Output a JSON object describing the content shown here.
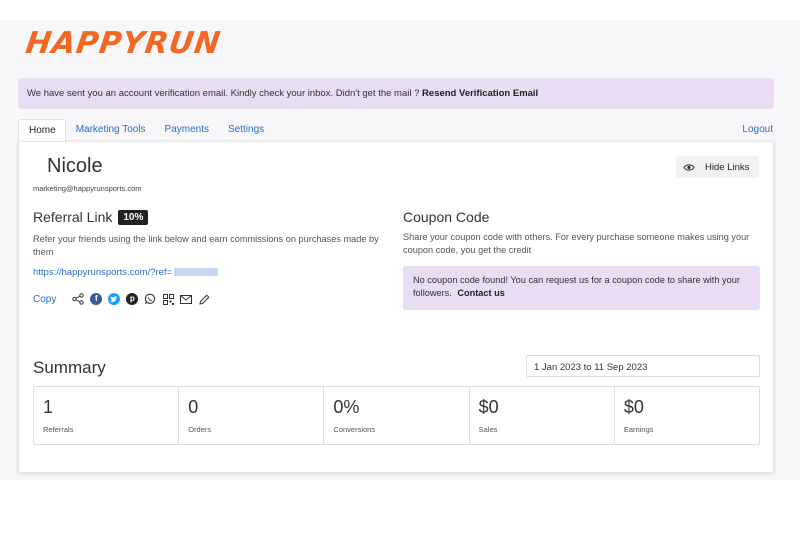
{
  "brand": {
    "logo_text": "HAPPYRUN",
    "accent": "#f26722"
  },
  "alert": {
    "message": "We have sent you an account verification email. Kindly check your inbox. Didn't get the mail ? ",
    "link": "Resend Verification Email"
  },
  "tabs": [
    {
      "label": "Home",
      "active": true
    },
    {
      "label": "Marketing Tools"
    },
    {
      "label": "Payments"
    },
    {
      "label": "Settings"
    }
  ],
  "logout_label": "Logout",
  "profile": {
    "name": "Nicole",
    "email": "marketing@happyrunsports.com"
  },
  "hide_links_label": "Hide Links",
  "referral": {
    "title": "Referral Link",
    "badge": "10%",
    "description": "Refer your friends using the link below and earn commissions on purchases made by them",
    "link": "https://happyrunsports.com/?ref=",
    "copy_label": "Copy",
    "share_icons": [
      "share-icon",
      "facebook-icon",
      "twitter-icon",
      "pinterest-icon",
      "whatsapp-icon",
      "qr-code-icon",
      "email-icon",
      "edit-icon"
    ]
  },
  "coupon": {
    "title": "Coupon Code",
    "description": "Share your coupon code with others. For every purchase someone makes using your coupon code, you get the credit",
    "notice": "No coupon code found! You can request us for a coupon code to share with your followers. ",
    "contact_link": "Contact us"
  },
  "summary": {
    "title": "Summary",
    "date_range": "1 Jan 2023 to 11 Sep 2023",
    "stats": [
      {
        "value": "1",
        "label": "Referrals"
      },
      {
        "value": "0",
        "label": "Orders"
      },
      {
        "value": "0%",
        "label": "Conversions"
      },
      {
        "value": "$0",
        "label": "Sales"
      },
      {
        "value": "$0",
        "label": "Earnings"
      }
    ]
  },
  "colors": {
    "link": "#2a6dc4",
    "alert_bg": "#e8ddf2",
    "facebook": "#3b5998",
    "twitter": "#1da1f2",
    "pinterest": "#bd081c"
  }
}
